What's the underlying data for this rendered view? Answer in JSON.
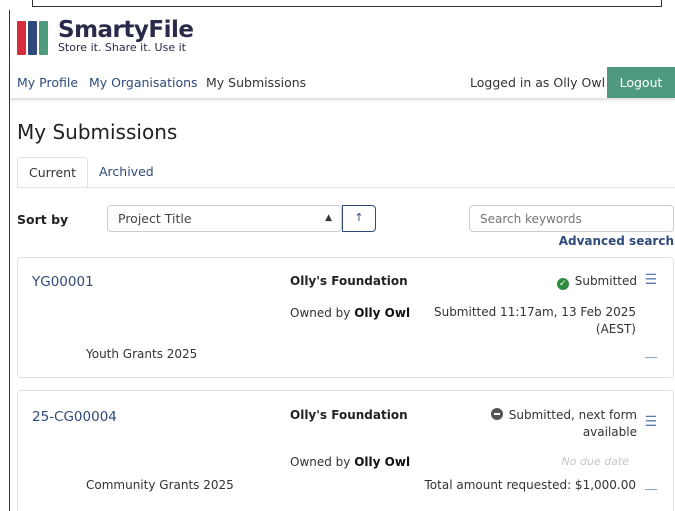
{
  "brand": {
    "name": "SmartyFile",
    "tagline": "Store it. Share it. Use it",
    "bar_colors": [
      "#d62e3c",
      "#2f4a7a",
      "#4f9a7e"
    ]
  },
  "nav": {
    "links": [
      "My Profile",
      "My Organisations",
      "My Submissions"
    ],
    "logged_in_text": "Logged in as Olly Owl",
    "logout_label": "Logout",
    "logout_color": "#4f9a7e"
  },
  "page": {
    "title": "My Submissions",
    "tabs": [
      "Current",
      "Archived"
    ]
  },
  "controls": {
    "sort_label": "Sort by",
    "sort_value": "Project Title",
    "sort_caret_icon": "select-caret-icon",
    "sort_direction_icon": "arrow-up-icon",
    "search_placeholder": "Search keywords",
    "advanced_search": "Advanced search"
  },
  "submissions": [
    {
      "id": "YG00001",
      "organisation": "Olly's Foundation",
      "owner_prefix": "Owned by",
      "owner": "Olly Owl",
      "status": "Submitted",
      "status_icon": "check-circle-icon",
      "submitted_line1": "Submitted 11:17am, 13 Feb 2025",
      "submitted_line2": "(AEST)",
      "round": "Youth Grants 2025"
    },
    {
      "id": "25-CG00004",
      "organisation": "Olly's Foundation",
      "owner_prefix": "Owned by",
      "owner": "Olly Owl",
      "status_line1": "Submitted, next form",
      "status_line2": "available",
      "status_icon": "minus-circle-icon",
      "due": "No due date",
      "round": "Community Grants 2025",
      "total": "Total amount requested: $1,000.00"
    }
  ]
}
